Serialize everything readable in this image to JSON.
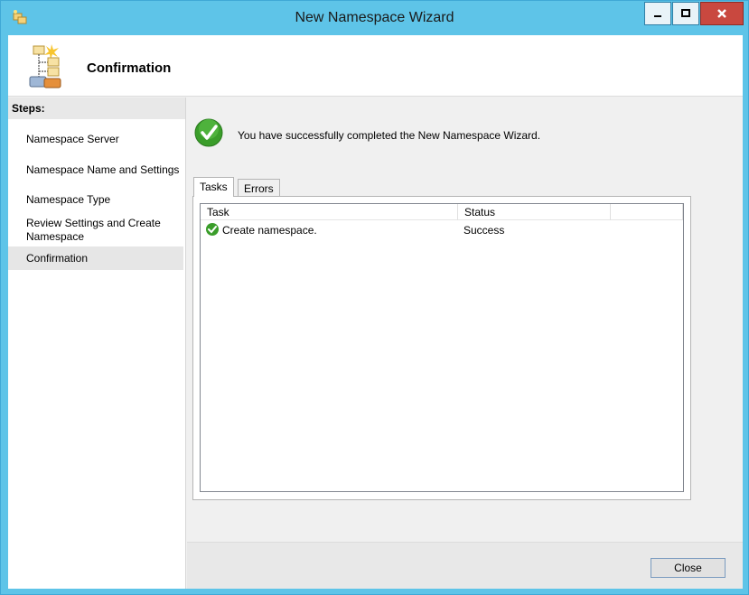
{
  "window": {
    "title": "New Namespace Wizard"
  },
  "header": {
    "title": "Confirmation"
  },
  "sidebar": {
    "heading": "Steps:",
    "steps": [
      {
        "label": "Namespace Server"
      },
      {
        "label": "Namespace Name and Settings"
      },
      {
        "label": "Namespace Type"
      },
      {
        "label": "Review Settings and Create Namespace"
      },
      {
        "label": "Confirmation",
        "active": true
      }
    ]
  },
  "content": {
    "message": "You have successfully completed the New Namespace Wizard.",
    "tabs": [
      {
        "label": "Tasks",
        "selected": true
      },
      {
        "label": "Errors",
        "selected": false
      }
    ],
    "table": {
      "columns": [
        "Task",
        "Status"
      ],
      "rows": [
        {
          "task": "Create namespace.",
          "status": "Success",
          "icon": "success-check-icon"
        }
      ]
    }
  },
  "footer": {
    "close_label": "Close"
  },
  "colors": {
    "titlebar": "#5ec4e8",
    "close_button": "#c9483f",
    "success_green": "#3a9d2a"
  }
}
